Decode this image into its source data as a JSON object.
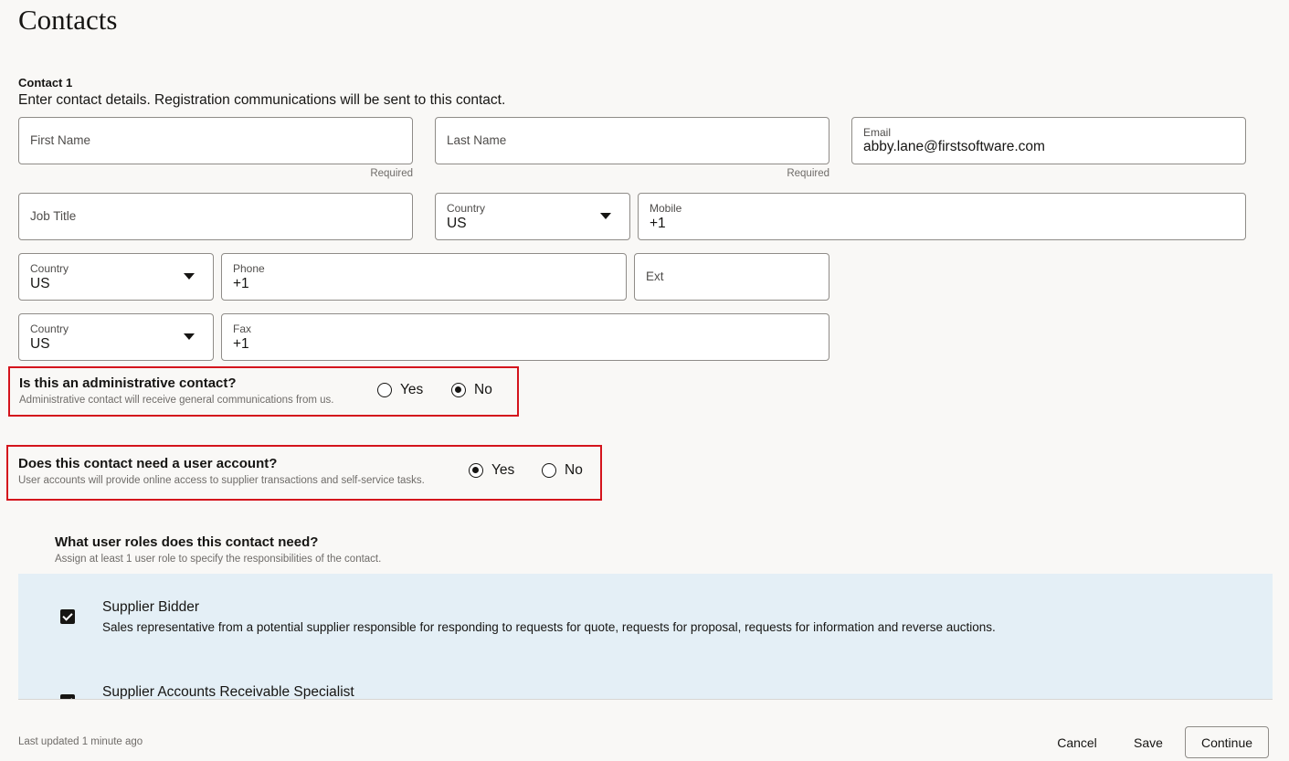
{
  "page": {
    "title": "Contacts"
  },
  "contact": {
    "heading": "Contact 1",
    "description": "Enter contact details. Registration communications will be sent to this contact.",
    "first_name": {
      "label": "First Name",
      "value": "",
      "helper": "Required"
    },
    "last_name": {
      "label": "Last Name",
      "value": "",
      "helper": "Required"
    },
    "email": {
      "label": "Email",
      "value": "abby.lane@firstsoftware.com"
    },
    "job_title": {
      "label": "Job Title",
      "value": ""
    },
    "mobile_country": {
      "label": "Country",
      "value": "US"
    },
    "mobile": {
      "label": "Mobile",
      "value": "+1"
    },
    "phone_country": {
      "label": "Country",
      "value": "US"
    },
    "phone": {
      "label": "Phone",
      "value": "+1"
    },
    "ext": {
      "label": "Ext",
      "value": ""
    },
    "fax_country": {
      "label": "Country",
      "value": "US"
    },
    "fax": {
      "label": "Fax",
      "value": "+1"
    }
  },
  "admin_question": {
    "title": "Is this an administrative contact?",
    "subtitle": "Administrative contact will receive general communications from us.",
    "options": [
      {
        "label": "Yes",
        "checked": false
      },
      {
        "label": "No",
        "checked": true
      }
    ]
  },
  "account_question": {
    "title": "Does this contact need a user account?",
    "subtitle": "User accounts will provide online access to supplier transactions and self-service tasks.",
    "options": [
      {
        "label": "Yes",
        "checked": true
      },
      {
        "label": "No",
        "checked": false
      }
    ]
  },
  "roles": {
    "title": "What user roles does this contact need?",
    "subtitle": "Assign at least 1 user role to specify the responsibilities of the contact.",
    "items": [
      {
        "name": "Supplier Bidder",
        "description": "Sales representative from a potential supplier responsible for responding to requests for quote, requests for proposal, requests for information and reverse auctions.",
        "checked": true
      },
      {
        "name": "Supplier Accounts Receivable Specialist",
        "description": "",
        "checked": true
      }
    ]
  },
  "footer": {
    "status": "Last updated 1 minute ago",
    "cancel_label": "Cancel",
    "save_label": "Save",
    "continue_label": "Continue"
  }
}
